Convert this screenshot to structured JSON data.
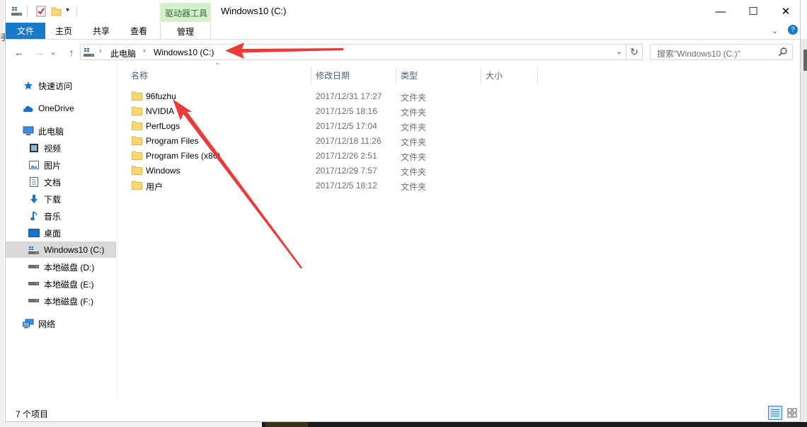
{
  "window": {
    "title": "Windows10 (C:)",
    "context_tab_group": "驱动器工具",
    "controls": {
      "minimize": "—",
      "maximize": "☐",
      "close": "✕"
    },
    "stray_left_char": "手"
  },
  "ribbon": {
    "tabs": [
      "文件",
      "主页",
      "共享",
      "查看",
      "管理"
    ],
    "active_tab_color": "#1979ca",
    "context_color": "#d5eecb"
  },
  "address": {
    "segments": [
      "此电脑",
      "Windows10 (C:)"
    ],
    "search_placeholder": "搜索\"Windows10 (C:)\""
  },
  "nav_pane": {
    "items": [
      {
        "label": "快速访问",
        "icon": "star-icon"
      },
      {
        "label": "OneDrive",
        "icon": "cloud-icon"
      },
      {
        "label": "此电脑",
        "icon": "computer-icon"
      },
      {
        "label": "视频",
        "icon": "video-icon"
      },
      {
        "label": "图片",
        "icon": "picture-icon"
      },
      {
        "label": "文档",
        "icon": "document-icon"
      },
      {
        "label": "下载",
        "icon": "download-icon"
      },
      {
        "label": "音乐",
        "icon": "music-icon"
      },
      {
        "label": "桌面",
        "icon": "desktop-icon"
      },
      {
        "label": "Windows10 (C:)",
        "icon": "system-drive-icon"
      },
      {
        "label": "本地磁盘 (D:)",
        "icon": "drive-icon"
      },
      {
        "label": "本地磁盘 (E:)",
        "icon": "drive-icon"
      },
      {
        "label": "本地磁盘 (F:)",
        "icon": "drive-icon"
      },
      {
        "label": "网络",
        "icon": "network-icon"
      }
    ],
    "selected": "Windows10 (C:)"
  },
  "file_list": {
    "columns": [
      "名称",
      "修改日期",
      "类型",
      "大小"
    ],
    "rows": [
      {
        "name": "96fuzhu",
        "date": "2017/12/31 17:27",
        "type": "文件夹"
      },
      {
        "name": "NVIDIA",
        "date": "2017/12/5 18:16",
        "type": "文件夹"
      },
      {
        "name": "PerfLogs",
        "date": "2017/12/5 17:04",
        "type": "文件夹"
      },
      {
        "name": "Program Files",
        "date": "2017/12/18 11:26",
        "type": "文件夹"
      },
      {
        "name": "Program Files (x86)",
        "date": "2017/12/26 2:51",
        "type": "文件夹"
      },
      {
        "name": "Windows",
        "date": "2017/12/29 7:57",
        "type": "文件夹"
      },
      {
        "name": "用户",
        "date": "2017/12/5 18:12",
        "type": "文件夹"
      }
    ]
  },
  "status_bar": {
    "item_count": "7 个项目"
  },
  "colors": {
    "annotation_arrow": "#ea3a3a",
    "folder": "#f8d775",
    "column_header": "#4c607a"
  }
}
